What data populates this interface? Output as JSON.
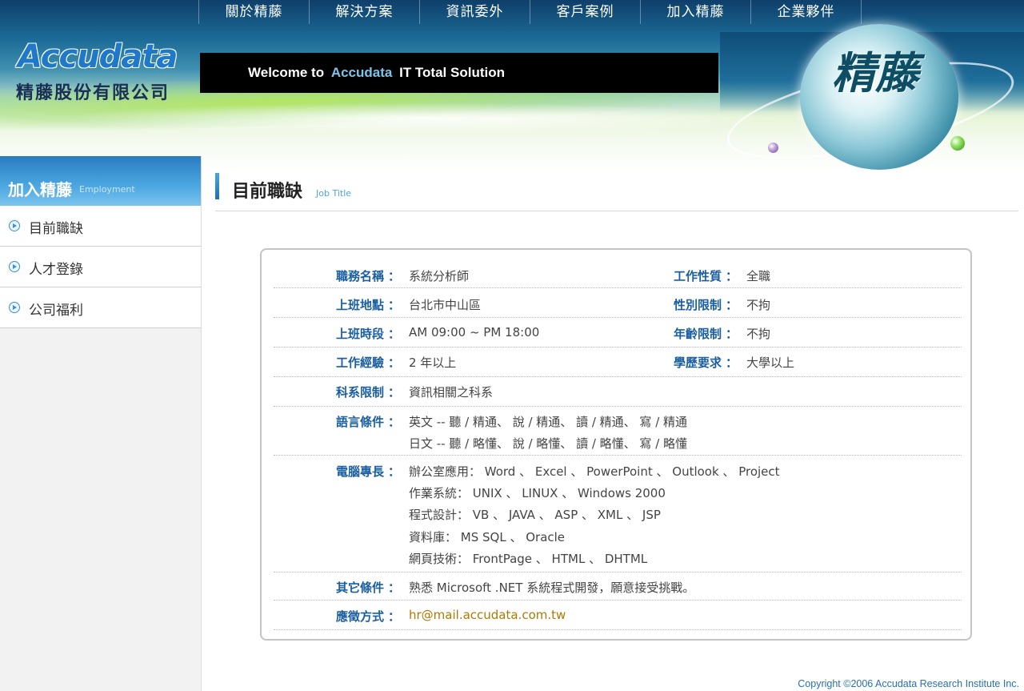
{
  "topnav": [
    "關於精藤",
    "解決方案",
    "資訊委外",
    "客戶案例",
    "加入精藤",
    "企業夥伴"
  ],
  "logo": {
    "brand": "Accudata",
    "company": "精藤股份有限公司"
  },
  "welcome": {
    "prefix": "Welcome to",
    "brand": "Accudata",
    "suffix": "IT Total Solution"
  },
  "globe_text": "精藤",
  "sidebar": {
    "title": "加入精藤",
    "title_en": "Employment",
    "items": [
      "目前職缺",
      "人才登錄",
      "公司福利"
    ]
  },
  "page": {
    "title": "目前職缺",
    "subtitle": "Job Title"
  },
  "job": {
    "sep": "：",
    "rows": [
      {
        "label": "職務名稱",
        "value": "系統分析師",
        "label2": "工作性質",
        "value2": "全職"
      },
      {
        "label": "上班地點",
        "value": "台北市中山區",
        "label2": "性別限制",
        "value2": "不拘"
      },
      {
        "label": "上班時段",
        "value": "AM 09:00 ~ PM 18:00",
        "label2": "年齡限制",
        "value2": "不拘"
      },
      {
        "label": "工作經驗",
        "value": "2 年以上",
        "label2": "學歷要求",
        "value2": "大學以上"
      },
      {
        "label": "科系限制",
        "value": "資訊相關之科系"
      }
    ],
    "language": {
      "label": "語言條件",
      "lines": [
        "英文 -- 聽 / 精通、 說 / 精通、 讀 / 精通、 寫 / 精通",
        "日文 -- 聽 / 略懂、 說 / 略懂、 讀 / 略懂、 寫 / 略懂"
      ]
    },
    "computer": {
      "label": "電腦專長",
      "lines": [
        "辦公室應用： Word 、 Excel 、 PowerPoint 、 Outlook 、 Project",
        "作業系統： UNIX 、 LINUX 、 Windows 2000",
        "程式設計： VB 、 JAVA 、 ASP 、 XML 、 JSP",
        "資料庫： MS SQL 、 Oracle",
        "網頁技術： FrontPage 、 HTML 、 DHTML"
      ]
    },
    "other": {
      "label": "其它條件",
      "value": "熟悉 Microsoft .NET 系統程式開發，願意接受挑戰。"
    },
    "apply": {
      "label": "應徵方式",
      "value": "hr@mail.accudata.com.tw"
    }
  },
  "footer": "Copyright ©2006 Accudata Research Institute Inc."
}
